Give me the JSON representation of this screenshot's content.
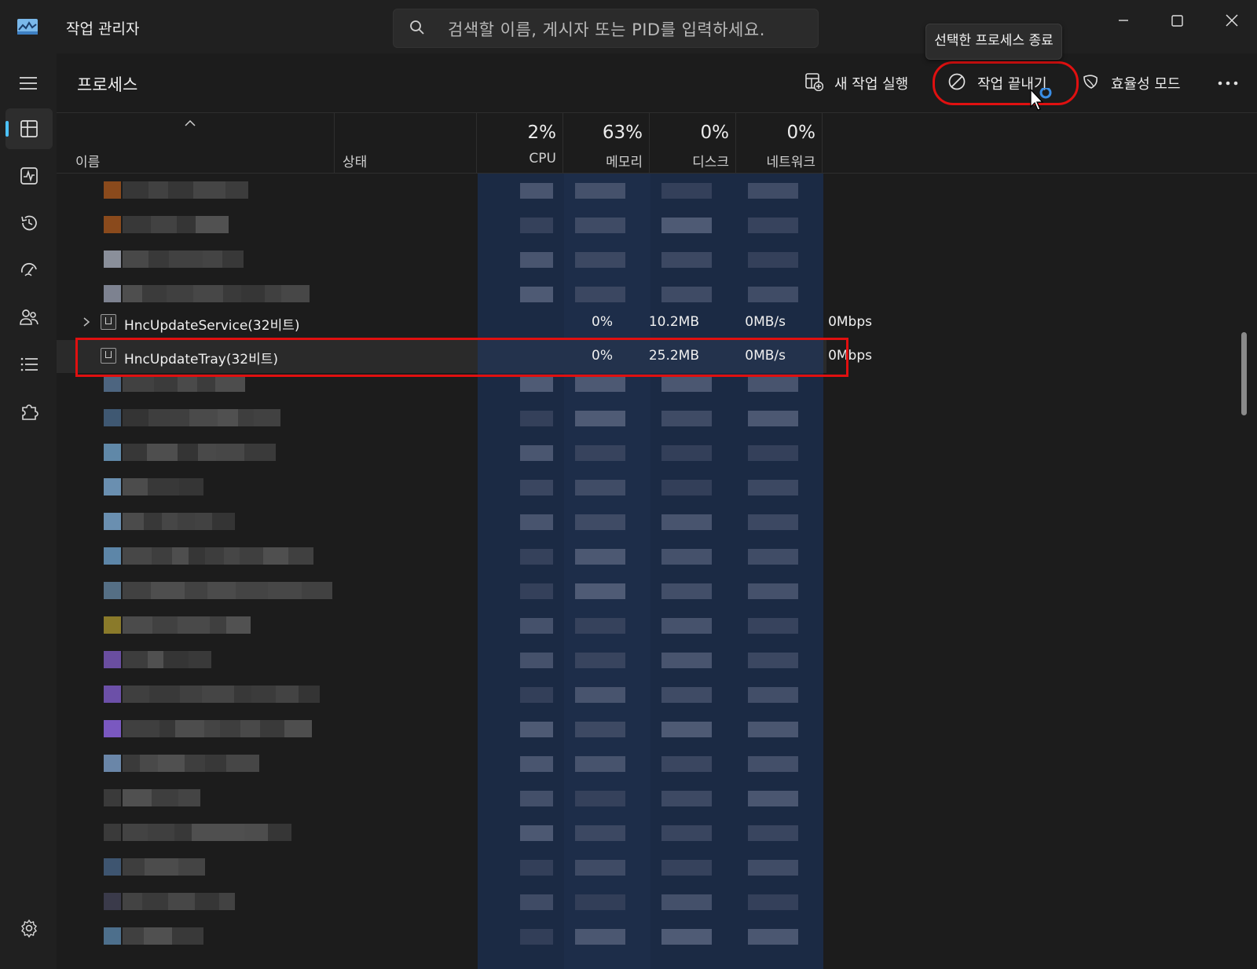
{
  "window": {
    "title": "작업 관리자",
    "search_placeholder": "검색할 이름, 게시자 또는 PID를 입력하세요."
  },
  "tooltip": "선택한 프로세스 종료",
  "page": {
    "title": "프로세스"
  },
  "toolbar": {
    "new_task": "새 작업 실행",
    "end_task": "작업 끝내기",
    "efficiency_mode": "효율성 모드"
  },
  "columns": {
    "name": "이름",
    "status": "상태",
    "cpu": {
      "label": "CPU",
      "pct": "2%"
    },
    "memory": {
      "label": "메모리",
      "pct": "63%"
    },
    "disk": {
      "label": "디스크",
      "pct": "0%"
    },
    "network": {
      "label": "네트워크",
      "pct": "0%"
    }
  },
  "processes": [
    {
      "name": "HncUpdateService(32비트)",
      "cpu": "0%",
      "memory": "10.2MB",
      "disk": "0MB/s",
      "network": "0Mbps",
      "expandable": true
    },
    {
      "name": "HncUpdateTray(32비트)",
      "cpu": "0%",
      "memory": "25.2MB",
      "disk": "0MB/s",
      "network": "0Mbps",
      "expandable": false
    }
  ],
  "colors": {
    "accent": "#4cc2ff",
    "highlight_red": "#e01010",
    "metric_band": "#1b2a44"
  }
}
